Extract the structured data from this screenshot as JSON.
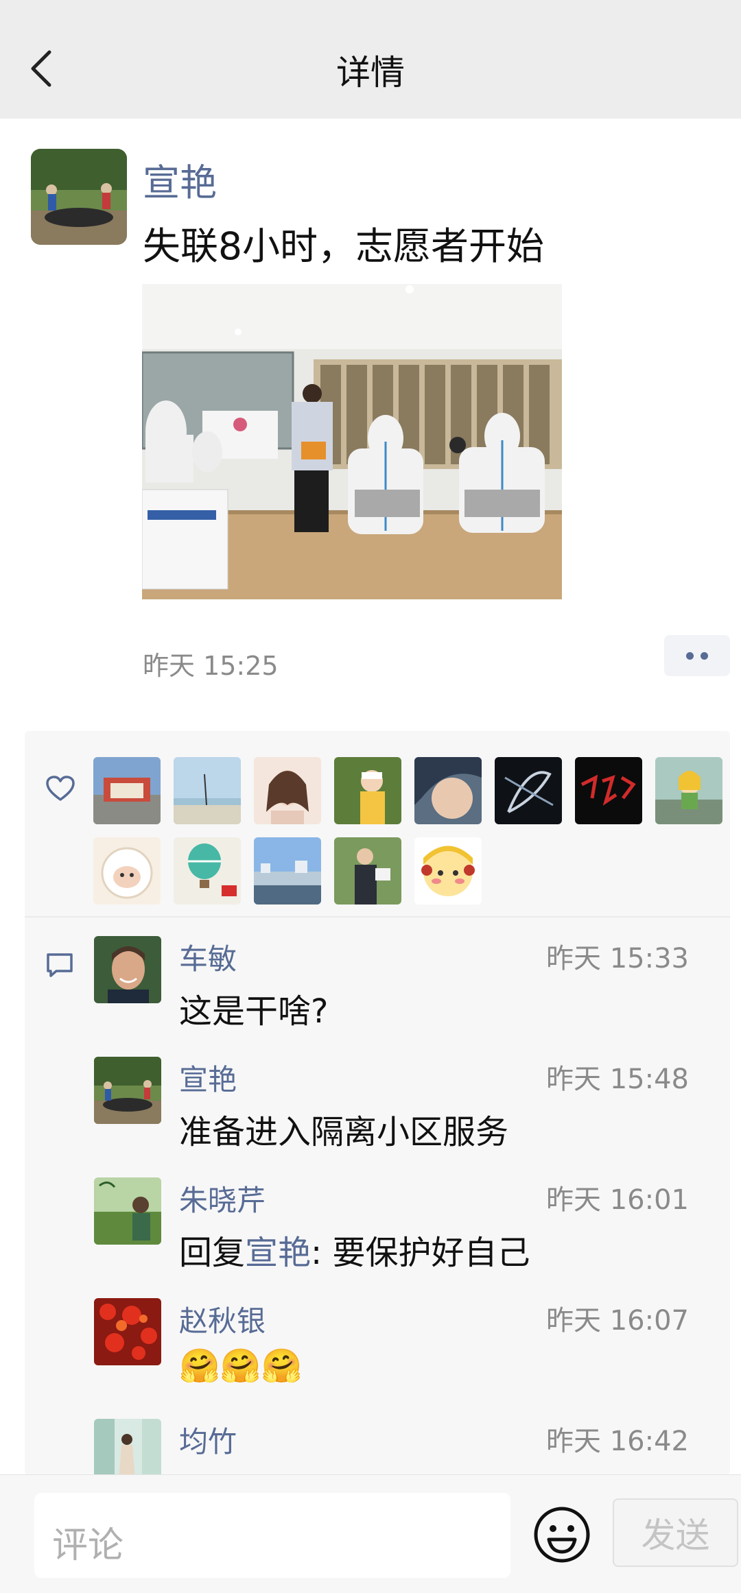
{
  "header": {
    "title": "详情",
    "back_icon": "chevron-left-icon"
  },
  "post": {
    "author": "宣艳",
    "text": "失联8小时，志愿者开始",
    "time": "昨天 15:25"
  },
  "likes": {
    "icon": "heart-icon",
    "avatars": [
      {
        "desc": "palace building"
      },
      {
        "desc": "sea kite"
      },
      {
        "desc": "illustrated girl"
      },
      {
        "desc": "child in garden"
      },
      {
        "desc": "child profile"
      },
      {
        "desc": "dark swirl"
      },
      {
        "desc": "red calligraphy"
      },
      {
        "desc": "cartoon girl"
      },
      {
        "desc": "sheep"
      },
      {
        "desc": "hot air balloon"
      },
      {
        "desc": "city riverside"
      },
      {
        "desc": "man with flower"
      },
      {
        "desc": "cartoon face"
      }
    ]
  },
  "comments": {
    "icon": "comment-icon",
    "items": [
      {
        "name": "车敏",
        "time": "昨天 15:33",
        "text": "这是干啥?"
      },
      {
        "name": "宣艳",
        "time": "昨天 15:48",
        "text": "准备进入隔离小区服务"
      },
      {
        "name": "朱晓芹",
        "time": "昨天 16:01",
        "reply_prefix": "回复",
        "reply_to": "宣艳",
        "text": ": 要保护好自己"
      },
      {
        "name": "赵秋银",
        "time": "昨天 16:07",
        "emoji": "🤗🤗🤗"
      },
      {
        "name": "均竹",
        "time": "昨天 16:42",
        "text": ""
      }
    ]
  },
  "composer": {
    "placeholder": "评论",
    "send_label": "发送",
    "emoji_icon": "smiley-icon"
  },
  "colors": {
    "link": "#576b95",
    "header_bg": "#ededed",
    "panel_bg": "#f7f7f7"
  }
}
